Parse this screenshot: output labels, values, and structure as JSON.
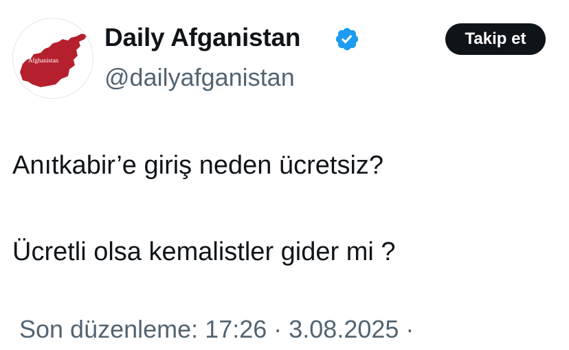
{
  "author": {
    "display_name": "Daily Afganistan",
    "handle": "@dailyafganistan",
    "verified": true,
    "avatar": {
      "icon": "afghanistan-map-icon",
      "map_label": "Afghanistan",
      "map_color": "#b5202e"
    }
  },
  "follow_button": {
    "label": "Takip et"
  },
  "tweet": {
    "line_1": "Anıtkabir’e giriş neden ücretsiz?",
    "line_2": "Ücretli olsa kemalistler gider mi ?"
  },
  "meta": {
    "text": "Son düzenleme: 17:26 · 3.08.2025  ·"
  },
  "colors": {
    "text_primary": "#0f1419",
    "text_secondary": "#536471",
    "verified_badge": "#1d9bf0",
    "button_bg": "#0f1419",
    "button_text": "#ffffff"
  }
}
